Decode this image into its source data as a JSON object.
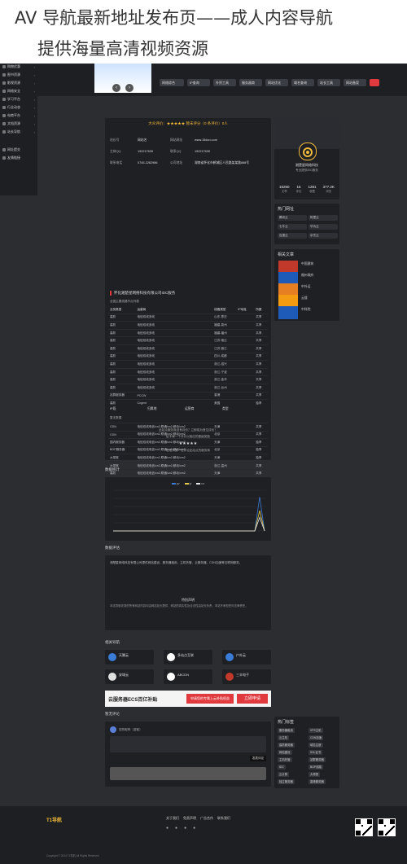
{
  "page_title": {
    "line1": "AV 导航最新地址发布页——成人内容导航",
    "line2": "提供海量高清视频资源"
  },
  "sidebar": {
    "items": [
      {
        "label": "网址导航",
        "icon": "home-icon"
      },
      {
        "label": "人工智能",
        "icon": "ai-icon"
      },
      {
        "label": "常用工具",
        "icon": "tools-icon"
      },
      {
        "label": "资源分享",
        "icon": "share-icon"
      },
      {
        "label": "娱乐休闲",
        "icon": "game-icon"
      },
      {
        "label": "生活服务",
        "icon": "life-icon"
      },
      {
        "label": "购物优惠",
        "icon": "cart-icon"
      },
      {
        "label": "图书资源",
        "icon": "book-icon"
      },
      {
        "label": "影视资源",
        "icon": "video-icon"
      },
      {
        "label": "网络安全",
        "icon": "shield-icon"
      },
      {
        "label": "学习平台",
        "icon": "study-icon"
      },
      {
        "label": "行业动态",
        "icon": "news-icon"
      },
      {
        "label": "电商平台",
        "icon": "shop-icon"
      },
      {
        "label": "文档资源",
        "icon": "doc-icon"
      },
      {
        "label": "站长导航",
        "icon": "site-icon"
      },
      {
        "label": "网址提交",
        "icon": "submit-icon"
      },
      {
        "label": "友情链接",
        "icon": "link-icon"
      }
    ]
  },
  "top_buttons": [
    {
      "label": "网络综合",
      "color": "#3b3d44"
    },
    {
      "label": "IP查询",
      "color": "#3b3d44"
    },
    {
      "label": "外贸工具",
      "color": "#3b3d44"
    },
    {
      "label": "服务器商",
      "color": "#3b3d44"
    },
    {
      "label": "网站优化",
      "color": "#3b3d44"
    },
    {
      "label": "域名查询",
      "color": "#3b3d44"
    },
    {
      "label": "站长工具",
      "color": "#3b3d44"
    },
    {
      "label": "网站备案",
      "color": "#3b3d44"
    },
    {
      "label": "",
      "color": "#e0393e"
    }
  ],
  "site_info": {
    "headline": "大众评价：★★★★★ 暂未评分（0 条评价）0人",
    "rows": [
      [
        "站长号",
        "网站名",
        "网站网址",
        "www.15dun.com"
      ],
      [
        "主体QQ",
        "192217639",
        "联系QQ",
        "192217639"
      ],
      [
        "联系电话",
        "0745-2262986",
        "公司地址",
        "湖南省怀化市鹤城区人民路某某路888号"
      ]
    ],
    "company_title": "怀化湘楚星网络科技有限公司IDC服务",
    "table_caption": "全国主要线路节点列表",
    "columns": [
      "业务类型",
      "运营商",
      "线路类型",
      "IP地址",
      "所属"
    ],
    "table_rows": [
      [
        "高防",
        "电信双线多线",
        "山东-枣庄",
        "共享"
      ],
      [
        "高防",
        "电信双线多线",
        "福建-泉州",
        "共享"
      ],
      [
        "高防",
        "电信双线多线",
        "福建-福州",
        "共享"
      ],
      [
        "高防",
        "电信双线多线",
        "江苏-宿迁",
        "共享"
      ],
      [
        "高防",
        "电信双线多线",
        "江苏-镇江",
        "共享"
      ],
      [
        "高防",
        "电信双线多线",
        "四川-成都",
        "共享"
      ],
      [
        "高防",
        "电信双线多线",
        "浙江-绍兴",
        "共享"
      ],
      [
        "高防",
        "电信双线多线",
        "浙江-宁波",
        "共享"
      ],
      [
        "高防",
        "电信双线多线",
        "浙江-金华",
        "共享"
      ],
      [
        "高防",
        "电信双线多线",
        "浙江-台州",
        "共享"
      ],
      [
        "站群服务器",
        "PCCW",
        "香港",
        "共享"
      ],
      [
        "高防",
        "Cogent",
        "美国",
        "独享"
      ],
      [
        "云主机",
        "电信双线电信/cn2,联通/cn2,移动/cm2",
        "天津",
        "共享"
      ],
      [
        "云主机",
        "电信双线电信/cn2,联通/cn2,移动/cm2",
        "北京",
        "共享"
      ],
      [
        "CDN",
        "电信双线电信/cn2,联通/cn2,移动/cm2",
        "天津",
        "共享"
      ],
      [
        "CDN",
        "电信双线电信/cn2,联通/cn2,移动/cm2",
        "北京",
        "共享"
      ],
      [
        "国内服务器",
        "电信双线电信/cn2,联通/cn2,移动/cm2",
        "天津",
        "独享"
      ],
      [
        "BGP服务器",
        "电信双线电信/cn2,联通/cn2,移动/cm2",
        "北京",
        "独享"
      ],
      [
        "大带宽",
        "电信双线电信/cn2,联通/cn2,移动/cm2",
        "天津",
        "独享"
      ],
      [
        "大带宽",
        "电信双线电信/cn2,联通/cn2,移动/cm2",
        "浙江-温州",
        "共享"
      ],
      [
        "高防",
        "电信双线电信/cn2,联通/cn2,移动/cm2",
        "天津",
        "共享"
      ],
      [
        "国内服务器",
        "电信双线电信/cn2,联通/cn2,移动/cm2",
        "北京",
        "独享"
      ],
      [
        "高防",
        "电信双线电信/cn2,联通/cn2,移动/cm2",
        "天津",
        "独享"
      ]
    ],
    "more": "更多 >>",
    "footer_cols": [
      "IP段",
      "归属地",
      "运营商",
      "类型"
    ],
    "footer_row": "暂无数据",
    "rate_prompt": "此站点服务商没有评价？立即成为首位评价！",
    "rate_sub": "给予每一个评价以相应的星级奖励",
    "rate_stars": "★★★★★",
    "rate_note": "您成为第一位评论此站点的服务商"
  },
  "stats_section": {
    "title": "数据统计",
    "legend": [
      "pv",
      "ip",
      "uv"
    ]
  },
  "chart_data": {
    "type": "line",
    "series": [
      {
        "name": "pv",
        "values": [
          0,
          0,
          0,
          0,
          0,
          0,
          0,
          0,
          0,
          0,
          0,
          0,
          0,
          0,
          0,
          0,
          0,
          0,
          0,
          0,
          0,
          0,
          0,
          0,
          0,
          0,
          0,
          0,
          0,
          0,
          5,
          0
        ]
      },
      {
        "name": "ip",
        "values": [
          0,
          0,
          0,
          0,
          0,
          0,
          0,
          0,
          0,
          0,
          0,
          0,
          0,
          0,
          0,
          0,
          0,
          0,
          0,
          0,
          0,
          0,
          0,
          0,
          0,
          0,
          0,
          0,
          0,
          0,
          3,
          0
        ]
      },
      {
        "name": "uv",
        "values": [
          0,
          0,
          0,
          0,
          0,
          0,
          0,
          0,
          0,
          0,
          0,
          0,
          0,
          0,
          0,
          0,
          0,
          0,
          0,
          0,
          0,
          0,
          0,
          0,
          0,
          0,
          0,
          0,
          0,
          0,
          2,
          0
        ]
      }
    ],
    "colors": [
      "#3a7bd5",
      "#e6c84a",
      "#e6e6e6"
    ]
  },
  "review_section": {
    "title": "数据评估",
    "text": "湘楚星网络科技有限公司提供网站建设、服务器租用、主机托管、云服务器、CDN加速等互联网服务。",
    "disclaimer_title": "特别声明",
    "disclaimer": "本站导航收录的所有网站内容均由网站站长提供，网站的真实性及合法性由站长负责，本站不承担任何法律责任。"
  },
  "related_section": {
    "title": "相关导航",
    "cards": [
      {
        "title": "天翼云",
        "color": "#3a7bd5"
      },
      {
        "title": "多站点互联",
        "color": "#ffffff"
      },
      {
        "title": "户外云",
        "color": "#3a7bd5"
      },
      {
        "title": "安域云",
        "color": "#e0e0e0"
      },
      {
        "title": "ABCDN",
        "color": "#ffffff"
      },
      {
        "title": "三丰电子",
        "color": "#c0392b"
      }
    ]
  },
  "ad_banner": {
    "left": "云服务器ECS百亿补贴",
    "mid": "申请您的专属上云补贴权益",
    "cta": "立即申请"
  },
  "comments": {
    "title": "暂无评论",
    "user": "您的昵称（游客）",
    "submit": "发表评论"
  },
  "profile": {
    "name": "湘楚星网络科技",
    "desc": "专业提供IDC服务",
    "stats": [
      {
        "value": "16250",
        "label": "文章"
      },
      {
        "value": "16",
        "label": "评论"
      },
      {
        "value": "1281",
        "label": "收藏"
      },
      {
        "value": "377.2K",
        "label": "浏览"
      }
    ]
  },
  "hot_sites": {
    "title": "热门网址",
    "items": [
      "腾讯云",
      "阿里云",
      "七牛云",
      "华为云",
      "百度云",
      "京东云"
    ]
  },
  "related_articles": {
    "title": "相关文章",
    "items": [
      {
        "label": "中国建筑",
        "thumb": "#c0392b"
      },
      {
        "label": "福州政府",
        "thumb": "#1e5bb8"
      },
      {
        "label": "中外运",
        "thumb": "#e67e22"
      },
      {
        "label": "云搜",
        "thumb": "#f39c12"
      },
      {
        "label": "中科院",
        "thumb": "#1e5bb8"
      }
    ]
  },
  "hot_tags": {
    "title": "热门标签",
    "tags": [
      "服务器租用",
      "VPS主机",
      "云主机",
      "CDN加速",
      "高防服务器",
      "域名注册",
      "网站建设",
      "SSL证书",
      "主机托管",
      "站群服务器",
      "IDC",
      "BGP线路",
      "云计算",
      "大带宽",
      "独立服务器",
      "香港服务器"
    ]
  },
  "footer": {
    "brand": "T1导航",
    "links": [
      "关于我们",
      "免责声明",
      "广告合作",
      "联系我们"
    ],
    "copy": "Copyright © 2024 T1导航 All Rights Reserved"
  }
}
